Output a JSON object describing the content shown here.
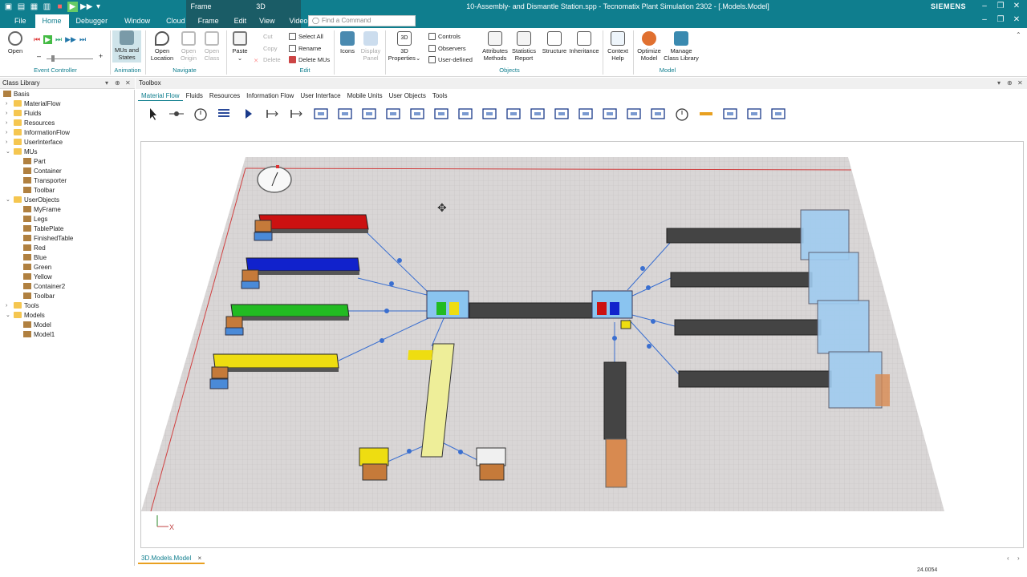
{
  "window": {
    "title": "10-Assembly- and Dismantle Station.spp - Tecnomatix Plant Simulation 2302 - [.Models.Model]",
    "brand": "SIEMENS",
    "context_tab_group_1": "Frame",
    "context_tab_group_2": "3D"
  },
  "ribbon_tabs": [
    "File",
    "Home",
    "Debugger",
    "Window",
    "Cloud",
    "Frame",
    "Edit",
    "View",
    "Video"
  ],
  "find": {
    "placeholder": "Find a Command"
  },
  "ribbon": {
    "open": "Open",
    "mus_states": "MUs and States",
    "open_location": "Open Location",
    "open_origin": "Open Origin",
    "open_class": "Open Class",
    "paste": "Paste",
    "cut": "Cut",
    "copy": "Copy",
    "delete": "Delete",
    "select_all": "Select All",
    "rename": "Rename",
    "delete_mus": "Delete MUs",
    "icons": "Icons",
    "display_panel": "Display Panel",
    "properties_3d": "3D Properties",
    "controls": "Controls",
    "observers": "Observers",
    "user_defined": "User-defined",
    "attributes_methods": "Attributes Methods",
    "statistics_report": "Statistics Report",
    "structure": "Structure",
    "inheritance": "Inheritance",
    "context_help": "Context Help",
    "optimize_model": "Optimize Model",
    "manage_class_library": "Manage Class Library",
    "groups": {
      "event_controller": "Event Controller",
      "animation": "Animation",
      "navigate": "Navigate",
      "edit": "Edit",
      "objects": "Objects",
      "model": "Model"
    }
  },
  "class_library": {
    "title": "Class Library",
    "items": [
      {
        "label": "Basis",
        "level": 0,
        "kind": "root",
        "exp": "–"
      },
      {
        "label": "MaterialFlow",
        "level": 1,
        "kind": "folder",
        "exp": "›"
      },
      {
        "label": "Fluids",
        "level": 1,
        "kind": "folder",
        "exp": "›"
      },
      {
        "label": "Resources",
        "level": 1,
        "kind": "folder",
        "exp": "›"
      },
      {
        "label": "InformationFlow",
        "level": 1,
        "kind": "folder",
        "exp": "›"
      },
      {
        "label": "UserInterface",
        "level": 1,
        "kind": "folder",
        "exp": "›"
      },
      {
        "label": "MUs",
        "level": 1,
        "kind": "folder",
        "exp": "⌄"
      },
      {
        "label": "Part",
        "level": 2,
        "kind": "item",
        "exp": ""
      },
      {
        "label": "Container",
        "level": 2,
        "kind": "item",
        "exp": ""
      },
      {
        "label": "Transporter",
        "level": 2,
        "kind": "item",
        "exp": ""
      },
      {
        "label": "Toolbar",
        "level": 2,
        "kind": "item",
        "exp": ""
      },
      {
        "label": "UserObjects",
        "level": 1,
        "kind": "folder",
        "exp": "⌄"
      },
      {
        "label": "MyFrame",
        "level": 2,
        "kind": "item",
        "exp": ""
      },
      {
        "label": "Legs",
        "level": 2,
        "kind": "item",
        "exp": ""
      },
      {
        "label": "TablePlate",
        "level": 2,
        "kind": "item",
        "exp": ""
      },
      {
        "label": "FinishedTable",
        "level": 2,
        "kind": "item",
        "exp": ""
      },
      {
        "label": "Red",
        "level": 2,
        "kind": "item",
        "exp": ""
      },
      {
        "label": "Blue",
        "level": 2,
        "kind": "item",
        "exp": ""
      },
      {
        "label": "Green",
        "level": 2,
        "kind": "item",
        "exp": ""
      },
      {
        "label": "Yellow",
        "level": 2,
        "kind": "item",
        "exp": ""
      },
      {
        "label": "Container2",
        "level": 2,
        "kind": "item",
        "exp": ""
      },
      {
        "label": "Toolbar",
        "level": 2,
        "kind": "item",
        "exp": ""
      },
      {
        "label": "Tools",
        "level": 1,
        "kind": "folder",
        "exp": "›"
      },
      {
        "label": "Models",
        "level": 1,
        "kind": "folder",
        "exp": "⌄"
      },
      {
        "label": "Model",
        "level": 2,
        "kind": "item",
        "exp": ""
      },
      {
        "label": "Model1",
        "level": 2,
        "kind": "item",
        "exp": ""
      }
    ]
  },
  "toolbox": {
    "title": "Toolbox",
    "tabs": [
      "Material Flow",
      "Fluids",
      "Resources",
      "Information Flow",
      "User Interface",
      "Mobile Units",
      "User Objects",
      "Tools"
    ],
    "tool_icons": [
      "pointer-icon",
      "connector-icon",
      "event-controller-icon",
      "source-icon",
      "drain-icon",
      "single-proc-icon",
      "parallel-proc-icon",
      "assembly-icon",
      "dismantle-icon",
      "buffer-icon",
      "placebuffer-icon",
      "sorter-icon",
      "cycle-icon",
      "store-icon",
      "track-icon",
      "line-icon",
      "turntable-icon",
      "turnplate-icon",
      "angular-converter-icon",
      "flowcontrol-icon",
      "track2-icon",
      "transfer-icon",
      "clock-icon",
      "hbw-icon",
      "gantry-icon",
      "structure-icon",
      "network-icon"
    ]
  },
  "document": {
    "tab": "3D.Models.Model",
    "close": "×"
  },
  "status": {
    "value": "24.0054"
  },
  "axis": {
    "x": "X"
  },
  "colors": {
    "accent": "#0f7e8e",
    "tab_underline": "#e9a020"
  }
}
